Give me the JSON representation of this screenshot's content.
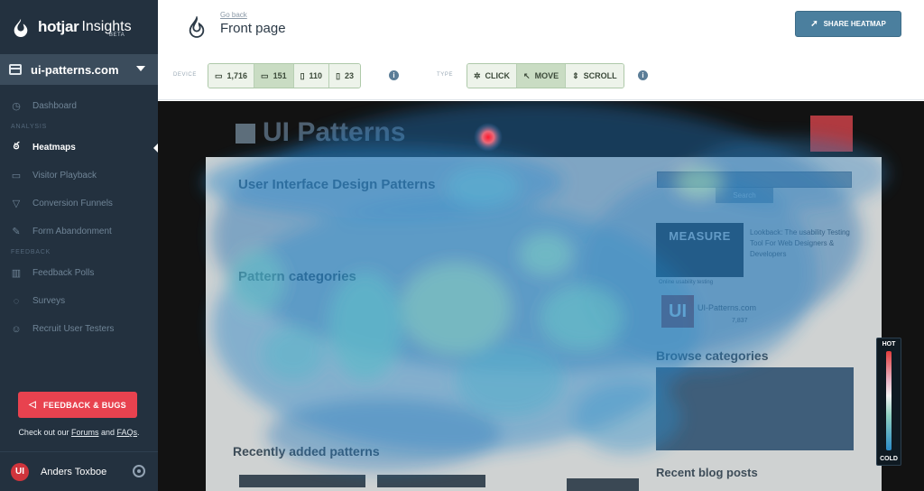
{
  "sidebar": {
    "brand": {
      "name": "hotjar",
      "product": "Insights",
      "badge": "BETA"
    },
    "site": "ui-patterns.com",
    "nav": [
      {
        "label": "Dashboard",
        "icon": "dashboard-icon"
      },
      {
        "section": "ANALYSIS"
      },
      {
        "label": "Heatmaps",
        "icon": "flame-icon",
        "active": true
      },
      {
        "label": "Visitor Playback",
        "icon": "film-icon"
      },
      {
        "label": "Conversion Funnels",
        "icon": "funnel-icon"
      },
      {
        "label": "Form Abandonment",
        "icon": "form-icon"
      },
      {
        "section": "FEEDBACK"
      },
      {
        "label": "Feedback Polls",
        "icon": "poll-icon"
      },
      {
        "label": "Surveys",
        "icon": "survey-icon"
      },
      {
        "label": "Recruit User Testers",
        "icon": "user-icon"
      }
    ],
    "feedback_button": "FEEDBACK & BUGS",
    "check_prefix": "Check out our ",
    "forums": "Forums",
    "and": " and ",
    "faqs": "FAQs",
    "check_suffix": ".",
    "user": {
      "initials": "UI",
      "name": "Anders Toxboe"
    }
  },
  "header": {
    "go_back": "Go back",
    "title": "Front page",
    "share": "SHARE HEATMAP",
    "device_label": "DEVICE",
    "devices": [
      {
        "value": "1,716",
        "icon": "desktop-icon",
        "active": false
      },
      {
        "value": "151",
        "icon": "laptop-icon",
        "active": true
      },
      {
        "value": "110",
        "icon": "tablet-icon",
        "active": false
      },
      {
        "value": "23",
        "icon": "phone-icon",
        "active": false
      }
    ],
    "type_label": "TYPE",
    "types": [
      {
        "value": "CLICK",
        "icon": "click-icon",
        "active": false
      },
      {
        "value": "MOVE",
        "icon": "cursor-icon",
        "active": true
      },
      {
        "value": "SCROLL",
        "icon": "scroll-icon",
        "active": false
      }
    ]
  },
  "heatmap": {
    "site_logo": "UI Patterns",
    "headline": "User Interface Design Patterns",
    "pattern_categories": "Pattern categories",
    "recently_added": "Recently added patterns",
    "search": "Search",
    "measure_title": "MEASURE",
    "lookback_title": "Lookback: The usability Testing Tool For Web Designers & Developers",
    "lookback_caption": "Online usability testing",
    "ui_site": "UI-Patterns.com",
    "ui_count": "7,837",
    "ui_logo": "UI",
    "browse_categories": "Browse categories",
    "recent_blog": "Recent blog posts",
    "legend_hot": "HOT",
    "legend_cold": "COLD"
  }
}
